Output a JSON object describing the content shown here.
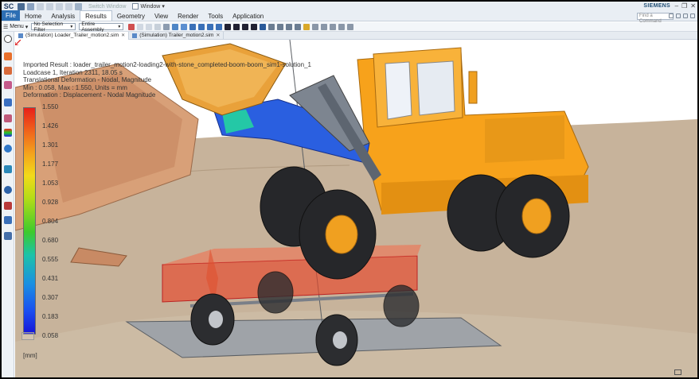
{
  "app": {
    "logo": "SC",
    "switch_window": "Switch Window",
    "window_menu": "Window",
    "brand": "SIEMENS",
    "window_controls": [
      "–",
      "❐",
      "✕"
    ]
  },
  "ribbon": {
    "file": "File",
    "tabs": [
      "Home",
      "Analysis",
      "Results",
      "Geometry",
      "View",
      "Render",
      "Tools",
      "Application"
    ],
    "active_tab": "Results",
    "command_search_placeholder": "Find a Command"
  },
  "selection_bar": {
    "menu": "Menu",
    "selection_filter": "No Selection Filter",
    "scope": "Entire Assembly"
  },
  "documents": [
    {
      "label": "(Simulation) Loader_Trailer_motion2.sim",
      "active": true
    },
    {
      "label": "(Simulation) Trailer_motion2.sim",
      "active": false
    }
  ],
  "result_info": {
    "line1": "Imported Result : loader_trailer_motion2-loading2-with-stone_completed-boom-boom_sim1-solution_1",
    "line2": "Loadcase 1, Iteration 2311, 18.05 s",
    "line3": "Translational Deformation - Nodal, Magnitude",
    "line4": "Min : 0.058, Max : 1.550, Units = mm",
    "line5": "Deformation : Displacement - Nodal Magnitude"
  },
  "legend": {
    "values": [
      "1.550",
      "1.426",
      "1.301",
      "1.177",
      "1.053",
      "0.928",
      "0.804",
      "0.680",
      "0.555",
      "0.431",
      "0.307",
      "0.183",
      "0.058"
    ],
    "unit": "[mm]",
    "max_color": "#e8201a",
    "min_color": "#1614d8"
  },
  "colors": {
    "accent": "#2d6fb4",
    "loader_body": "#f7a21b",
    "ground": "#c7b39b",
    "trailer_highlight": "#e8462a"
  }
}
